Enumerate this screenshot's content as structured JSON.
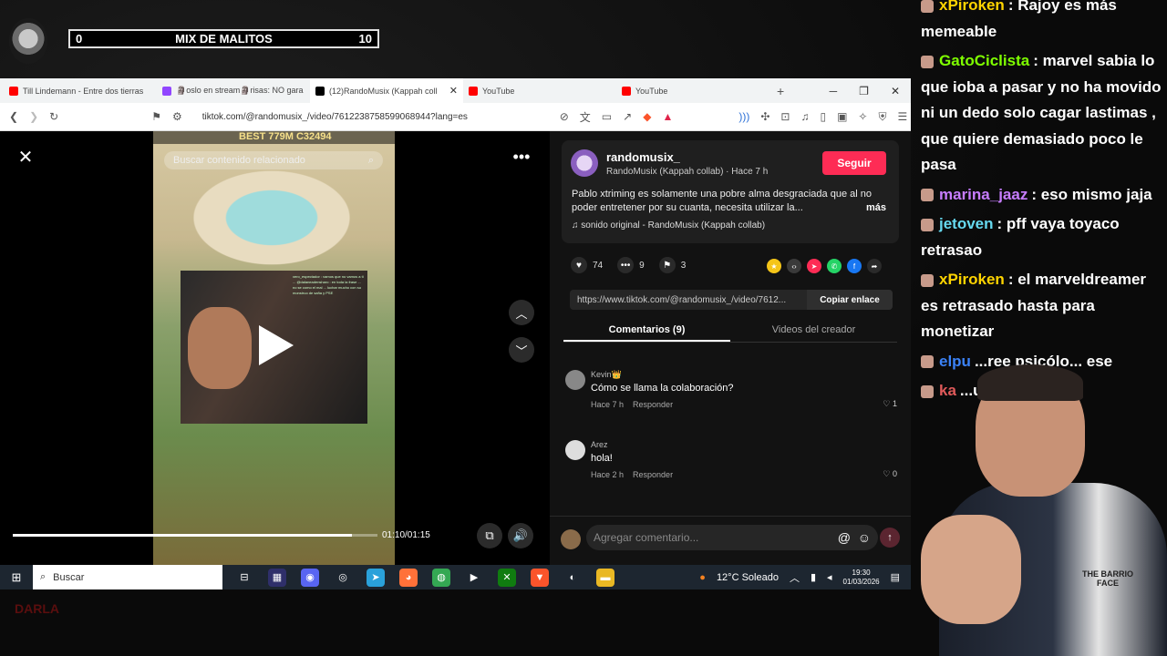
{
  "overlay": {
    "score_left": "0",
    "score_title": "MIX DE MALITOS",
    "score_right": "10",
    "corner_logo": "DARLA"
  },
  "browser": {
    "tabs": [
      {
        "label": "Till Lindemann - Entre dos tierras",
        "color": "#ff0000",
        "active": false
      },
      {
        "label": "🗿oslo en stream🗿risas: NO gara",
        "color": "#9146ff",
        "active": false
      },
      {
        "label": "(12)RandoMusix (Kappah coll",
        "color": "#000000",
        "active": true
      },
      {
        "label": "YouTube",
        "color": "#ff0000",
        "active": false
      },
      {
        "label": "YouTube",
        "color": "#ff0000",
        "active": false
      }
    ],
    "new_tab_icon": "plus-icon",
    "url": "tiktok.com/@randomusix_/video/7612238758599068944?lang=es"
  },
  "video": {
    "score_strip": "BEST 779M   C32494",
    "search_placeholder": "Buscar contenido relacionado",
    "time": "01:10/01:15",
    "progress": 0.93,
    "webcam_chat": "xero_espectador : vamos que no vamos a ti ... @dalaneadensharo : en toda la frase ... no se como el mal ... luchar mucho con su monstruo de saña y PSE"
  },
  "post": {
    "username": "randomusix_",
    "subline": "RandoMusix (Kappah collab) · Hace 7 h",
    "follow": "Seguir",
    "description": "Pablo xtriming es solamente una pobre alma desgraciada que al no poder entretener por su cuanta, necesita utilizar la...",
    "more": "más",
    "sound": "sonido original - RandoMusix (Kappah collab)",
    "likes": "74",
    "comments": "9",
    "saves": "3",
    "link": "https://www.tiktok.com/@randomusix_/video/7612...",
    "copy_link": "Copiar enlace",
    "tab_comments": "Comentarios (9)",
    "tab_videos": "Videos del creador",
    "share_colors": [
      "#f5c518",
      "#3a3a3a",
      "#fe2c55",
      "#25d366",
      "#1877f2",
      "#2a2a2a"
    ]
  },
  "comments": [
    {
      "user": "Kevin👑",
      "text": "Cómo se llama la colaboración?",
      "time": "Hace 7 h",
      "reply": "Responder",
      "likes": "1"
    },
    {
      "user": "Arez",
      "text": "hola!",
      "time": "Hace 2 h",
      "reply": "Responder",
      "likes": "0"
    }
  ],
  "comment_input": {
    "placeholder": "Agregar comentario..."
  },
  "taskbar": {
    "search": "Buscar",
    "weather": "12°C  Soleado",
    "time": "19:30",
    "date": "01/03/2026"
  },
  "chat": [
    {
      "user": "xPiroken",
      "color": "#ffd400",
      "text": ": Rajoy es más memeable"
    },
    {
      "user": "GatoCiclista",
      "color": "#7fff00",
      "text": ": marvel sabia lo que ioba a pasar y no ha movido ni un dedo solo cagar lastimas , que quiere demasiado poco le pasa"
    },
    {
      "user": "marina_jaaz",
      "color": "#c77dff",
      "text": ": eso mismo jaja"
    },
    {
      "user": "jetoven",
      "color": "#66d9ef",
      "text": ": pff vaya toyaco retrasao"
    },
    {
      "user": "xPiroken",
      "color": "#ffd400",
      "text": ": el marveldreamer es retrasado hasta para monetizar"
    },
    {
      "user": "elpu",
      "color": "#3b82f6",
      "text": "...ree psicólo... ese"
    },
    {
      "user": "ka",
      "color": "#e05a5a",
      "text": "...un criajo"
    }
  ],
  "streamer_print": "THE BARRIO FACE"
}
